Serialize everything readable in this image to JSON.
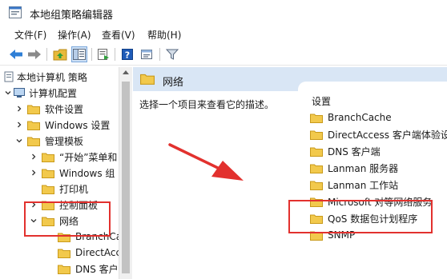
{
  "window": {
    "title": "本地组策略编辑器"
  },
  "menu": [
    {
      "label": "文件(F)"
    },
    {
      "label": "操作(A)"
    },
    {
      "label": "查看(V)"
    },
    {
      "label": "帮助(H)"
    }
  ],
  "toolbar": {
    "buttons": [
      {
        "icon": "back-arrow-icon"
      },
      {
        "icon": "forward-arrow-icon"
      },
      {
        "icon": "up-folder-icon"
      },
      {
        "icon": "show-hide-tree-icon"
      },
      {
        "icon": "export-list-icon"
      },
      {
        "icon": "help-icon"
      },
      {
        "icon": "properties-icon"
      },
      {
        "icon": "filter-icon"
      }
    ]
  },
  "tree": {
    "root": "本地计算机 策略",
    "computer_config": "计算机配置",
    "items": [
      {
        "label": "软件设置"
      },
      {
        "label": "Windows 设置"
      },
      {
        "label": "管理模板"
      },
      {
        "label": "“开始”菜单和"
      },
      {
        "label": "Windows 组"
      },
      {
        "label": "打印机"
      },
      {
        "label": "控制面板"
      },
      {
        "label": "网络"
      },
      {
        "label": "BranchCa"
      },
      {
        "label": "DirectAcc"
      },
      {
        "label": "DNS 客户"
      }
    ]
  },
  "right": {
    "header": "网络",
    "description": "选择一个项目来查看它的描述。",
    "column_header": "设置",
    "items": [
      {
        "label": "BranchCache"
      },
      {
        "label": "DirectAccess 客户端体验设置"
      },
      {
        "label": "DNS 客户端"
      },
      {
        "label": "Lanman 服务器"
      },
      {
        "label": "Lanman 工作站"
      },
      {
        "label": "Microsoft 对等网络服务"
      },
      {
        "label": "QoS 数据包计划程序"
      },
      {
        "label": "SNMP"
      }
    ]
  },
  "colors": {
    "accent_blue": "#1e66c8",
    "header_bar": "#d9e6f5",
    "folder_yellow": "#f2c94c",
    "highlight_red": "#e2312e"
  }
}
